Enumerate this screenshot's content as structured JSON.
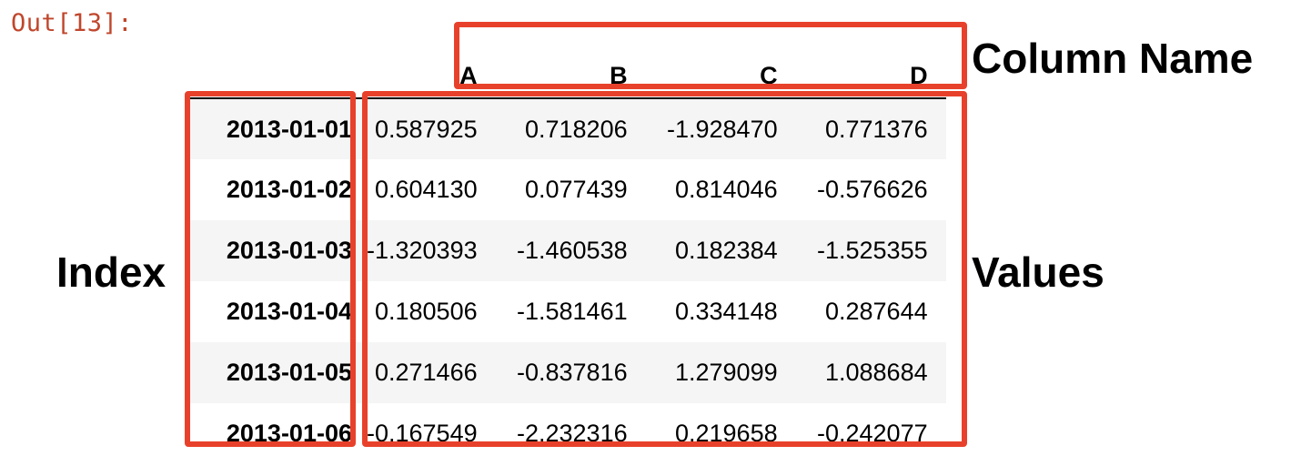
{
  "cell_prompt": "Out[13]:",
  "table": {
    "columns": [
      "A",
      "B",
      "C",
      "D"
    ],
    "rows": [
      {
        "index": "2013-01-01",
        "values": [
          "0.587925",
          "0.718206",
          "-1.928470",
          "0.771376"
        ]
      },
      {
        "index": "2013-01-02",
        "values": [
          "0.604130",
          "0.077439",
          "0.814046",
          "-0.576626"
        ]
      },
      {
        "index": "2013-01-03",
        "values": [
          "-1.320393",
          "-1.460538",
          "0.182384",
          "-1.525355"
        ]
      },
      {
        "index": "2013-01-04",
        "values": [
          "0.180506",
          "-1.581461",
          "0.334148",
          "0.287644"
        ]
      },
      {
        "index": "2013-01-05",
        "values": [
          "0.271466",
          "-0.837816",
          "1.279099",
          "1.088684"
        ]
      },
      {
        "index": "2013-01-06",
        "values": [
          "-0.167549",
          "-2.232316",
          "0.219658",
          "-0.242077"
        ]
      }
    ]
  },
  "annotations": {
    "column_name": "Column Name",
    "index": "Index",
    "values": "Values"
  },
  "colors": {
    "highlight_box": "#e8412b",
    "prompt": "#c0462b",
    "stripe": "#f5f5f5"
  }
}
